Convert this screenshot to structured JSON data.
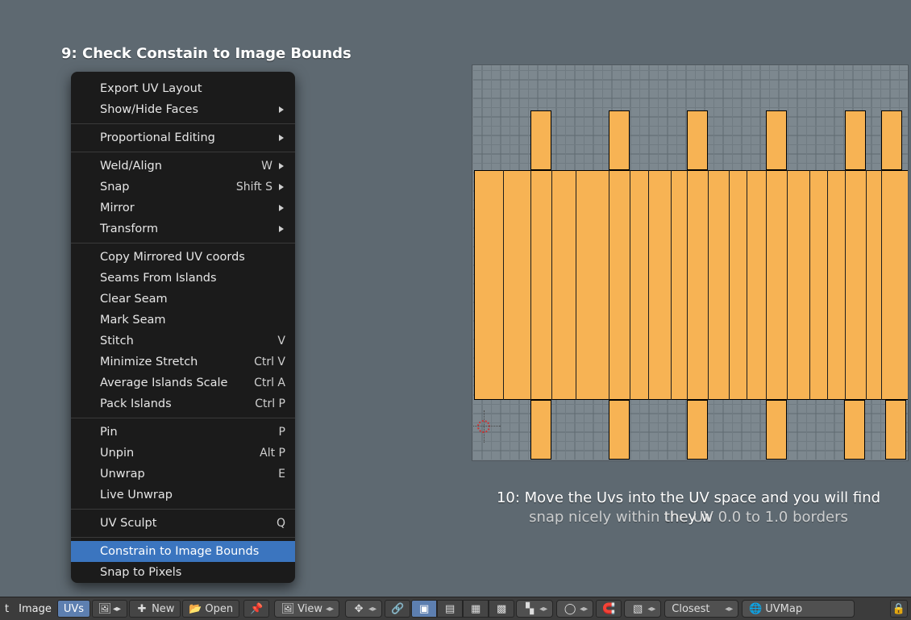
{
  "captions": {
    "step9": "9: Check Constain to Image Bounds",
    "step10a": "10: Move the Uvs into the UV space and you will find they w",
    "step10b": "snap nicely  within the UV 0.0 to 1.0 borders"
  },
  "menu": {
    "export_uv": "Export UV Layout",
    "show_hide": "Show/Hide Faces",
    "prop_edit": "Proportional Editing",
    "weld": "Weld/Align",
    "weld_key": "W",
    "snap": "Snap",
    "snap_key": "Shift S",
    "mirror": "Mirror",
    "transform": "Transform",
    "copy_mirrored": "Copy Mirrored UV coords",
    "seams_islands": "Seams From Islands",
    "clear_seam": "Clear Seam",
    "mark_seam": "Mark Seam",
    "stitch": "Stitch",
    "stitch_key": "V",
    "min_stretch": "Minimize Stretch",
    "min_stretch_key": "Ctrl V",
    "avg_scale": "Average Islands Scale",
    "avg_scale_key": "Ctrl A",
    "pack_islands": "Pack Islands",
    "pack_islands_key": "Ctrl P",
    "pin": "Pin",
    "pin_key": "P",
    "unpin": "Unpin",
    "unpin_key": "Alt P",
    "unwrap": "Unwrap",
    "unwrap_key": "E",
    "live_unwrap": "Live Unwrap",
    "uv_sculpt": "UV Sculpt",
    "uv_sculpt_key": "Q",
    "constrain": "Constrain to Image Bounds",
    "snap_pixels": "Snap to Pixels"
  },
  "header": {
    "t_label": "t",
    "image_label": "Image",
    "uvs_label": "UVs",
    "new_label": "New",
    "open_label": "Open",
    "view_label": "View",
    "closest_label": "Closest",
    "uvmap_label": "UVMap"
  },
  "uv": {
    "tabs_up_x": [
      70,
      167,
      264,
      362,
      460,
      505
    ],
    "tabs_dn_x": [
      70,
      167,
      264,
      362,
      459,
      510
    ],
    "vlines_x": [
      36,
      70,
      96,
      126,
      167,
      193,
      216,
      244,
      264,
      290,
      316,
      338,
      362,
      388,
      416,
      438,
      460,
      486,
      505
    ]
  }
}
